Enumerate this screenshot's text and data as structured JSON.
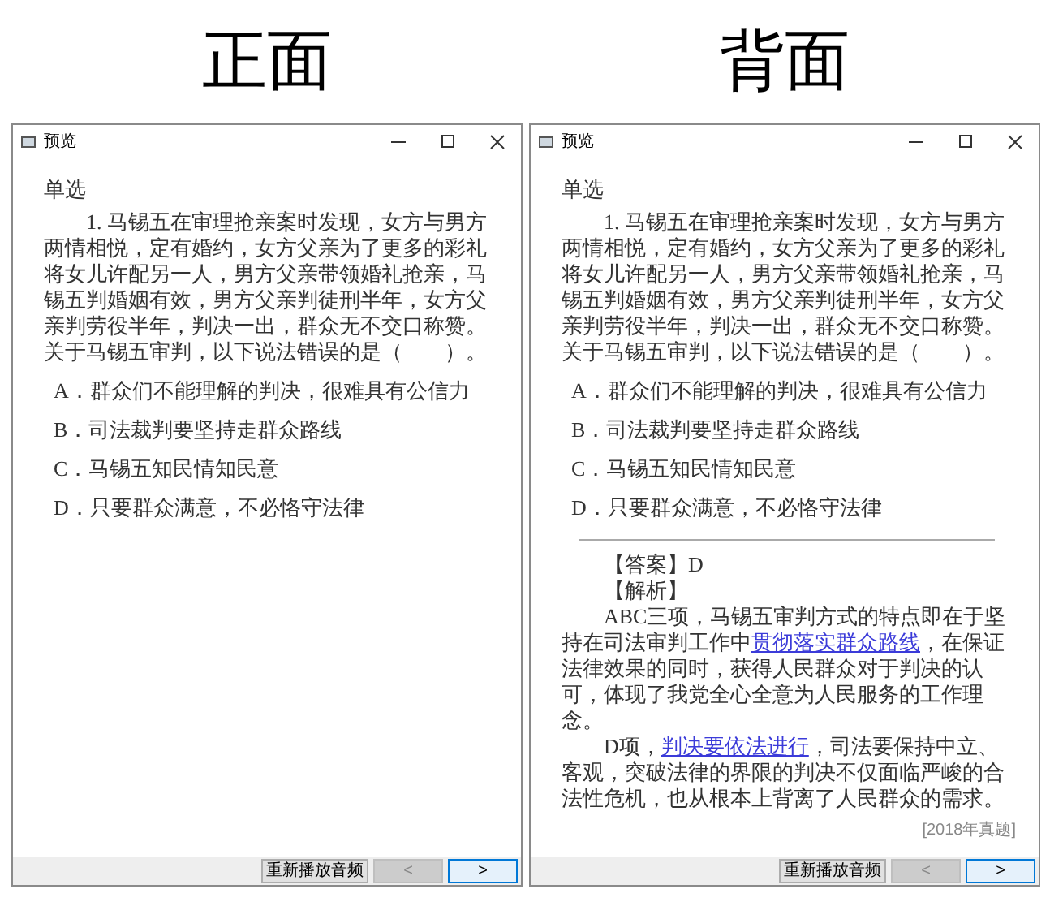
{
  "panels": [
    {
      "heading": "正面",
      "window": {
        "title": "预览"
      },
      "question_type": "单选",
      "question": "1. 马锡五在审理抢亲案时发现，女方与男方两情相悦，定有婚约，女方父亲为了更多的彩礼将女儿许配另一人，男方父亲带领婚礼抢亲，马锡五判婚姻有效，男方父亲判徒刑半年，女方父亲判劳役半年，判决一出，群众无不交口称赞。关于马锡五审判，以下说法错误的是（　　）。",
      "options": [
        "A．群众们不能理解的判决，很难具有公信力",
        "B．司法裁判要坚持走群众路线",
        "C．马锡五知民情知民意",
        "D．只要群众满意，不必恪守法律"
      ],
      "buttons": {
        "replay": "重新播放音频",
        "prev": {
          "label": "<",
          "disabled": true
        },
        "next": {
          "label": ">",
          "focused": true
        }
      }
    },
    {
      "heading": "背面",
      "window": {
        "title": "预览"
      },
      "question_type": "单选",
      "question": "1. 马锡五在审理抢亲案时发现，女方与男方两情相悦，定有婚约，女方父亲为了更多的彩礼将女儿许配另一人，男方父亲带领婚礼抢亲，马锡五判婚姻有效，男方父亲判徒刑半年，女方父亲判劳役半年，判决一出，群众无不交口称赞。关于马锡五审判，以下说法错误的是（　　）。",
      "options": [
        "A．群众们不能理解的判决，很难具有公信力",
        "B．司法裁判要坚持走群众路线",
        "C．马锡五知民情知民意",
        "D．只要群众满意，不必恪守法律"
      ],
      "answer": {
        "answer_line": "【答案】D",
        "analysis_label": "【解析】",
        "paragraphs": [
          [
            {
              "kind": "text",
              "text": "ABC三项，马锡五审判方式的特点即在于坚持在司法审判工作中"
            },
            {
              "kind": "link",
              "text": "贯彻落实群众路线"
            },
            {
              "kind": "text",
              "text": "，在保证法律效果的同时，获得人民群众对于判决的认可，体现了我党全心全意为人民服务的工作理念。"
            }
          ],
          [
            {
              "kind": "text",
              "text": "D项，"
            },
            {
              "kind": "link",
              "text": "判决要依法进行"
            },
            {
              "kind": "text",
              "text": "，司法要保持中立、客观，突破法律的界限的判决不仅面临严峻的合法性危机，也从根本上背离了人民群众的需求。"
            }
          ]
        ],
        "source": "[2018年真题]"
      },
      "buttons": {
        "replay": "重新播放音频",
        "prev": {
          "label": "<",
          "disabled": true
        },
        "next": {
          "label": ">",
          "focused": true
        }
      }
    }
  ]
}
